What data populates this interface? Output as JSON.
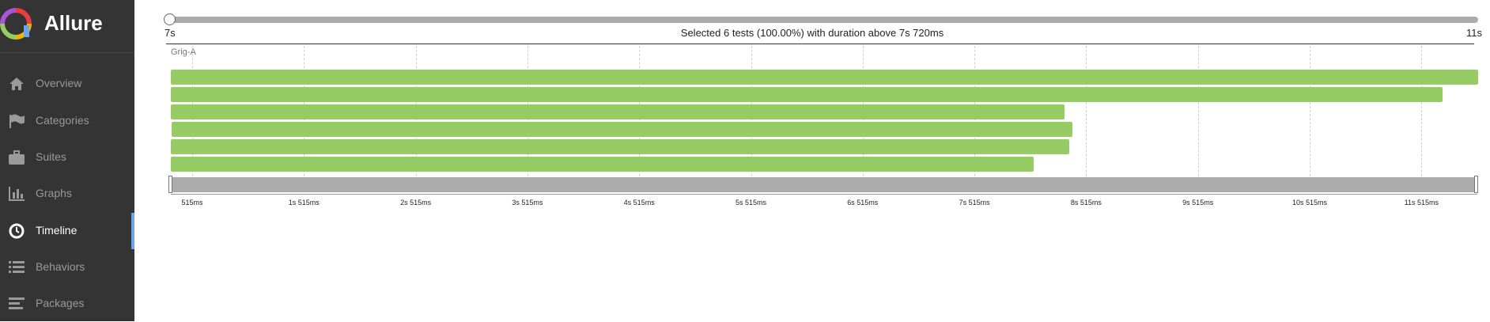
{
  "brand": {
    "title": "Allure",
    "logo_icon": "allure-logo-icon"
  },
  "sidebar": {
    "items": [
      {
        "label": "Overview",
        "icon": "home-icon",
        "active": false
      },
      {
        "label": "Categories",
        "icon": "flag-icon",
        "active": false
      },
      {
        "label": "Suites",
        "icon": "briefcase-icon",
        "active": false
      },
      {
        "label": "Graphs",
        "icon": "bar-chart-icon",
        "active": false
      },
      {
        "label": "Timeline",
        "icon": "clock-icon",
        "active": true
      },
      {
        "label": "Behaviors",
        "icon": "list-icon",
        "active": false
      },
      {
        "label": "Packages",
        "icon": "align-left-icon",
        "active": false
      }
    ]
  },
  "duration_filter": {
    "min_label": "7s",
    "max_label": "11s",
    "selection_text": "Selected 6 tests (100.00%) with duration above 7s 720ms"
  },
  "timeline": {
    "group": "Grig-A",
    "tick_labels": [
      "515ms",
      "1s 515ms",
      "2s 515ms",
      "3s 515ms",
      "4s 515ms",
      "5s 515ms",
      "6s 515ms",
      "7s 515ms",
      "8s 515ms",
      "9s 515ms",
      "10s 515ms",
      "11s 515ms"
    ],
    "bar_color": "#97cc64",
    "tests": [
      {
        "start_s": 0.0,
        "end_s": 11.7
      },
      {
        "start_s": 0.0,
        "end_s": 11.38
      },
      {
        "start_s": 0.0,
        "end_s": 8.0
      },
      {
        "start_s": 0.01,
        "end_s": 8.07
      },
      {
        "start_s": 0.0,
        "end_s": 8.04
      },
      {
        "start_s": 0.0,
        "end_s": 7.72
      }
    ]
  },
  "colors": {
    "sidebar_bg": "#343434",
    "active_indicator": "#6aa7ea",
    "slider": "#ababab"
  }
}
